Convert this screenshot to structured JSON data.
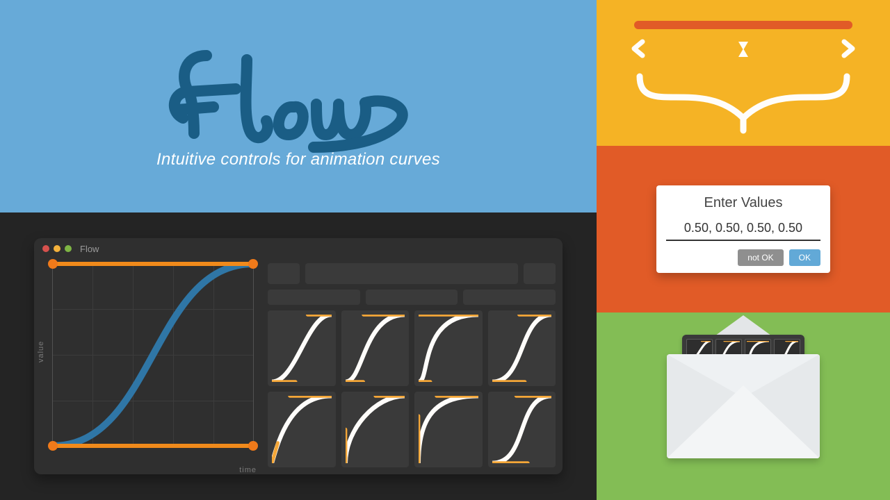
{
  "hero": {
    "product_name": "Flow",
    "tagline": "Intuitive controls for animation curves"
  },
  "app_window": {
    "title": "Flow",
    "axis_y_label": "value",
    "axis_x_label": "time"
  },
  "dialog": {
    "title": "Enter Values",
    "input_value": "0.50, 0.50, 0.50, 0.50",
    "cancel_label": "not OK",
    "ok_label": "OK"
  },
  "colors": {
    "hero_bg": "#67aad8",
    "workspace_bg": "#242424",
    "app_bg": "#2f2f2f",
    "accent_orange": "#f08a1b",
    "curve_blue": "#2f76a6",
    "yellow_panel": "#f5b325",
    "orange_panel": "#e15b27",
    "green_panel": "#83bd55"
  },
  "chart_data": {
    "type": "line",
    "title": "Bezier easing curve",
    "xlabel": "time",
    "ylabel": "value",
    "xlim": [
      0,
      1
    ],
    "ylim": [
      0,
      1
    ],
    "bezier": {
      "p0": [
        0,
        0
      ],
      "cp1": [
        0.5,
        0.0
      ],
      "cp2": [
        0.5,
        1.0
      ],
      "p1": [
        1,
        1
      ]
    },
    "presets": [
      {
        "cp1": [
          0.4,
          0.0
        ],
        "cp2": [
          0.6,
          1.0
        ]
      },
      {
        "cp1": [
          0.3,
          0.0
        ],
        "cp2": [
          0.3,
          1.0
        ]
      },
      {
        "cp1": [
          0.2,
          0.0
        ],
        "cp2": [
          0.0,
          1.0
        ]
      },
      {
        "cp1": [
          0.55,
          0.0
        ],
        "cp2": [
          0.45,
          1.0
        ]
      },
      {
        "cp1": [
          0.1,
          0.3
        ],
        "cp2": [
          0.3,
          1.0
        ]
      },
      {
        "cp1": [
          0.0,
          0.5
        ],
        "cp2": [
          0.5,
          1.0
        ]
      },
      {
        "cp1": [
          0.0,
          0.7
        ],
        "cp2": [
          0.3,
          1.0
        ]
      },
      {
        "cp1": [
          0.6,
          0.0
        ],
        "cp2": [
          0.4,
          1.0
        ]
      }
    ]
  }
}
